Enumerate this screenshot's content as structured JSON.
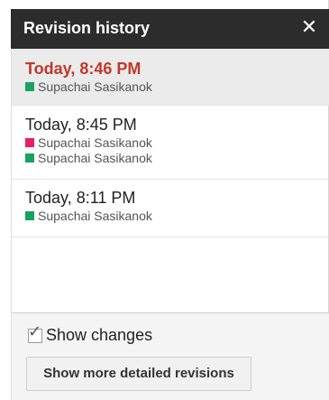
{
  "header": {
    "title": "Revision history",
    "close_symbol": "✕"
  },
  "revisions": [
    {
      "time": "Today, 8:46 PM",
      "selected": true,
      "authors": [
        {
          "name": "Supachai Sasikanok",
          "color": "#1aa260"
        }
      ]
    },
    {
      "time": "Today, 8:45 PM",
      "selected": false,
      "authors": [
        {
          "name": "Supachai Sasikanok",
          "color": "#e91e63"
        },
        {
          "name": "Supachai Sasikanok",
          "color": "#1aa260"
        }
      ]
    },
    {
      "time": "Today, 8:11 PM",
      "selected": false,
      "authors": [
        {
          "name": "Supachai Sasikanok",
          "color": "#1aa260"
        }
      ]
    }
  ],
  "footer": {
    "show_changes_label": "Show changes",
    "show_changes_checked": true,
    "more_button_label": "Show more detailed revisions"
  },
  "colors": {
    "selected_time": "#c0392b",
    "header_bg": "#2c2c2c"
  }
}
